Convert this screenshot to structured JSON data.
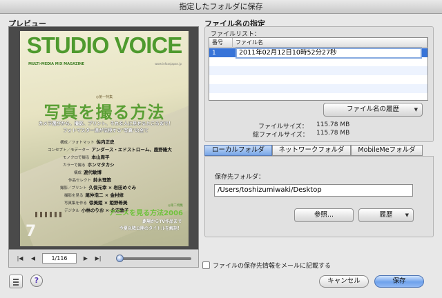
{
  "window": {
    "title": "指定したフォルダに保存"
  },
  "preview": {
    "title": "プレビュー",
    "cover": {
      "magazine_title": "STUDIO VOICE",
      "subtitle": "MULTI-MEDIA MIX MAGAZINE",
      "url": "www.infoasjapan.jp",
      "feature_tag": "◎第一特集",
      "headline": "写真を撮る方法",
      "lead_line1": "カメラ選びから、撮影、プリント、それを人に見せるところまで！",
      "lead_line2": "フォトマスター達が伝授する\"写真\"の全て",
      "credits": [
        {
          "role": "構成／フォトマット",
          "name": "佐内正史"
        },
        {
          "role": "コンセプト／モデーター",
          "name": "アンダース・エドストローム、鹿野隆大"
        },
        {
          "role": "モノクロで撮る",
          "name": "本山周平"
        },
        {
          "role": "カラーで撮る",
          "name": "ホンマタカシ"
        },
        {
          "role": "構成",
          "name": "渡代敏博"
        },
        {
          "role": "作品セレクト",
          "name": "鈴木理策"
        },
        {
          "role": "撮影／プリント",
          "name": "久保元幸 × 岩田めぐみ"
        },
        {
          "role": "撮影を見る",
          "name": "尾仲浩二 × 金村修"
        },
        {
          "role": "写真集を作る",
          "name": "徐美姫 × 姫野希美"
        },
        {
          "role": "デジタル",
          "name": "小林のりお × 永沼敦子"
        }
      ],
      "issue_number": "7",
      "second_feature_tag": "◎第二特集",
      "second_headline": "アニメを見る方法2006",
      "second_lead1": "劇場からTV作品まで",
      "second_lead2": "今夏以降公開のタイトルを解剖！"
    },
    "nav": {
      "page_indicator": "1/116",
      "first_label": "|◀",
      "prev_label": "◀",
      "next_label": "▶",
      "last_label": "▶|",
      "zoom_position": 0.0
    }
  },
  "filename_panel": {
    "title": "ファイル名の指定",
    "list_caption": "ファイルリスト：",
    "columns": {
      "index": "番号",
      "name": "ファイル名"
    },
    "rows": [
      {
        "index": "1",
        "name": "2011年02月12日10時52分27秒",
        "selected": true
      }
    ],
    "history_button": "ファイル名の履歴",
    "file_size_label": "ファイルサイズ：",
    "file_size_value": "115.78 MB",
    "total_size_label": "総ファイルサイズ：",
    "total_size_value": "115.78 MB"
  },
  "destination": {
    "tabs": [
      {
        "label": "ローカルフォルダ",
        "active": true
      },
      {
        "label": "ネットワークフォルダ",
        "active": false
      },
      {
        "label": "MobileMeフォルダ",
        "active": false
      }
    ],
    "folder_label": "保存先フォルダ：",
    "folder_path": "/Users/toshizumiwaki/Desktop",
    "browse_button": "参照...",
    "history_button": "履歴"
  },
  "options": {
    "mail_checkbox_label": "ファイルの保存先情報をメールに記載する",
    "mail_checkbox_checked": false
  },
  "footer": {
    "help_label": "?",
    "cancel_button": "キャンセル",
    "save_button": "保存"
  },
  "colors": {
    "accent": "#3874d8",
    "cover_green": "#5a9f35"
  }
}
